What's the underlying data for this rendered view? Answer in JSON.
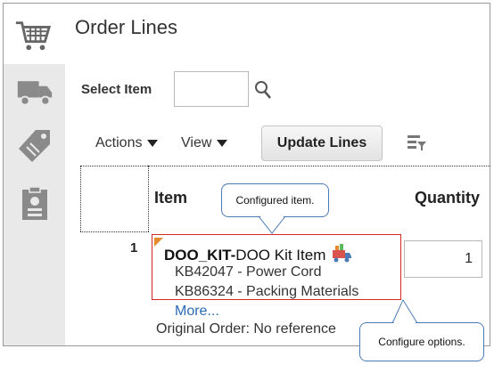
{
  "page": {
    "title": "Order Lines"
  },
  "sidebar": {
    "items": [
      "cart-icon",
      "truck-icon",
      "tag-icon",
      "badge-icon"
    ]
  },
  "search": {
    "label": "Select Item",
    "value": ""
  },
  "toolbar": {
    "actions_label": "Actions",
    "view_label": "View",
    "update_label": "Update Lines"
  },
  "table": {
    "headers": {
      "item": "Item",
      "quantity": "Quantity"
    },
    "rows": [
      {
        "number": "1",
        "item_code": "DOO_KIT-",
        "item_name": " DOO Kit Item",
        "components": [
          "KB42047 - Power Cord",
          "KB86324 - Packing Materials"
        ],
        "more": "More...",
        "original_order": "Original Order: No reference",
        "quantity": "1"
      }
    ]
  },
  "callouts": {
    "configured_item": "Configured  item.",
    "configure_options": "Configure  options."
  },
  "colors": {
    "highlight_border": "#d52828",
    "link": "#2a6ab5",
    "callout_border": "#4a7ab8",
    "flag": "#e48a2c"
  }
}
